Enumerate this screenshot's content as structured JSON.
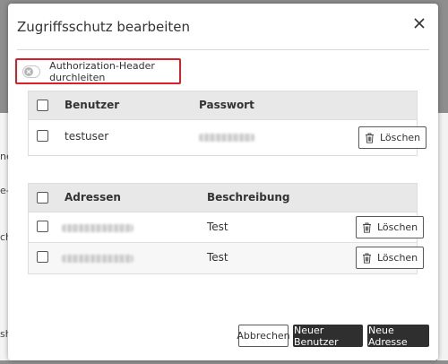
{
  "background": {
    "fragments": [
      "ne",
      "e-r",
      "ch",
      "sh"
    ]
  },
  "dialog": {
    "title": "Zugriffsschutz bearbeiten",
    "close_icon": "close-icon",
    "toggle": {
      "label": "Authorization-Header durchleiten",
      "state": "off"
    },
    "users_table": {
      "columns": [
        "Benutzer",
        "Passwort"
      ],
      "rows": [
        {
          "user": "testuser",
          "password": "",
          "delete_label": "Löschen"
        }
      ]
    },
    "addresses_table": {
      "columns": [
        "Adressen",
        "Beschreibung"
      ],
      "rows": [
        {
          "address": "",
          "description": "Test",
          "delete_label": "Löschen"
        },
        {
          "address": "",
          "description": "Test",
          "delete_label": "Löschen"
        }
      ]
    },
    "footer": {
      "cancel_label": "Abbrechen",
      "new_user_label": "Neuer Benutzer",
      "new_address_label": "Neue Adresse"
    }
  },
  "colors": {
    "highlight_border": "#d9202a",
    "dark_button": "#2f2f2f",
    "table_header": "#e8e8e8"
  }
}
